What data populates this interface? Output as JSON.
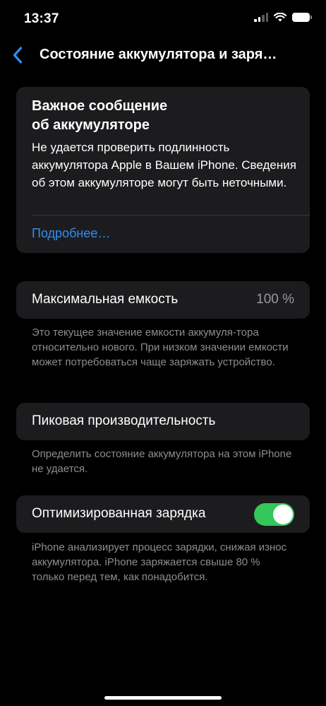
{
  "status_bar": {
    "time": "13:37"
  },
  "nav": {
    "title": "Состояние аккумулятора и заря…"
  },
  "important_message": {
    "title_line1": "Важное сообщение",
    "title_line2": "об аккумуляторе",
    "body": "Не удается проверить подлинность аккумулятора Apple в Вашем iPhone. Сведения об этом аккумуляторе могут быть неточными.",
    "link": "Подробнее…"
  },
  "max_capacity": {
    "label": "Максимальная емкость",
    "value": "100 %",
    "footnote": "Это текущее значение емкости аккумуля-тора относительно нового. При низком значении емкости может потребоваться чаще заряжать устройство."
  },
  "peak_performance": {
    "label": "Пиковая производительность",
    "footnote": "Определить состояние аккумулятора на этом iPhone не удается."
  },
  "optimized_charging": {
    "label": "Оптимизированная зарядка",
    "enabled": true,
    "footnote": "iPhone анализирует процесс зарядки, снижая износ аккумулятора. iPhone заряжается свыше 80 % только перед тем, как понадобится."
  },
  "colors": {
    "accent": "#2f8df5",
    "toggle_on": "#34c759",
    "card_bg": "#1c1c1e",
    "secondary_text": "#8d8d93"
  }
}
